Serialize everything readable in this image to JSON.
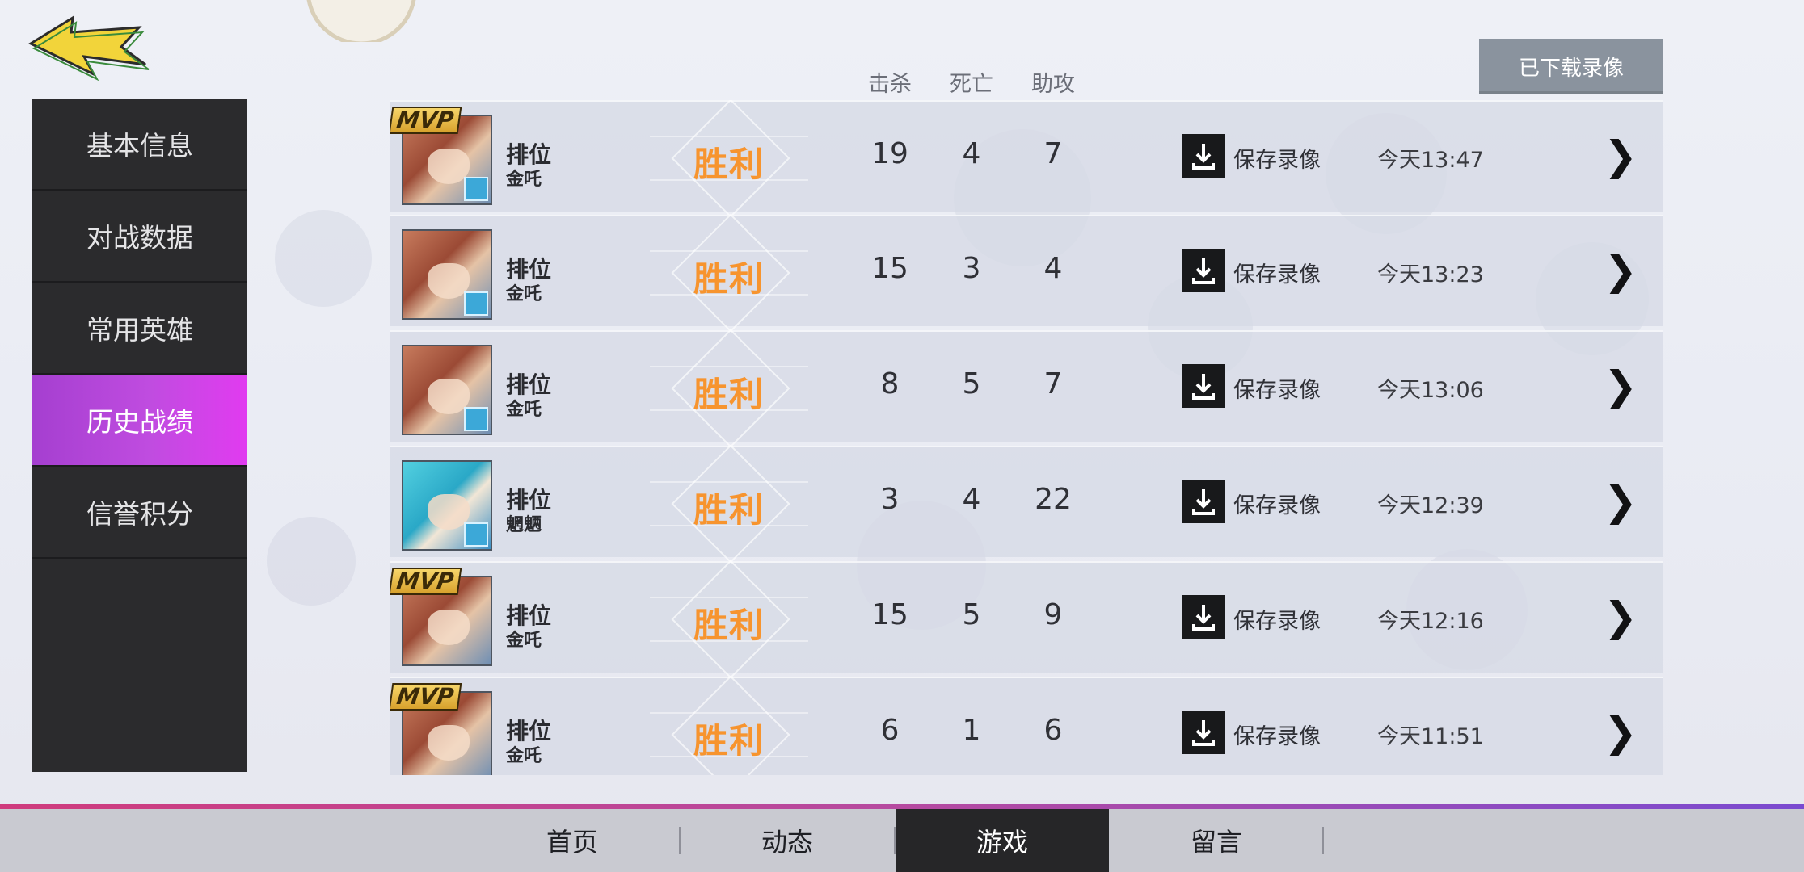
{
  "sidebar": {
    "items": [
      {
        "label": "基本信息"
      },
      {
        "label": "对战数据"
      },
      {
        "label": "常用英雄"
      },
      {
        "label": "历史战绩"
      },
      {
        "label": "信誉积分"
      }
    ]
  },
  "stats_header": {
    "kills": "击杀",
    "deaths": "死亡",
    "assists": "助攻"
  },
  "downloaded_button": "已下载录像",
  "matches": [
    {
      "mvp": "MVP",
      "mode": "排位",
      "hero": "金吒",
      "result": "胜利",
      "kills": "19",
      "deaths": "4",
      "assists": "7",
      "save": "保存录像",
      "time": "今天13:47"
    },
    {
      "mvp": "",
      "mode": "排位",
      "hero": "金吒",
      "result": "胜利",
      "kills": "15",
      "deaths": "3",
      "assists": "4",
      "save": "保存录像",
      "time": "今天13:23"
    },
    {
      "mvp": "",
      "mode": "排位",
      "hero": "金吒",
      "result": "胜利",
      "kills": "8",
      "deaths": "5",
      "assists": "7",
      "save": "保存录像",
      "time": "今天13:06"
    },
    {
      "mvp": "",
      "mode": "排位",
      "hero": "魍魉",
      "result": "胜利",
      "kills": "3",
      "deaths": "4",
      "assists": "22",
      "save": "保存录像",
      "time": "今天12:39"
    },
    {
      "mvp": "MVP",
      "mode": "排位",
      "hero": "金吒",
      "result": "胜利",
      "kills": "15",
      "deaths": "5",
      "assists": "9",
      "save": "保存录像",
      "time": "今天12:16"
    },
    {
      "mvp": "MVP",
      "mode": "排位",
      "hero": "金吒",
      "result": "胜利",
      "kills": "6",
      "deaths": "1",
      "assists": "6",
      "save": "保存录像",
      "time": "今天11:51"
    }
  ],
  "bottom_nav": {
    "tabs": [
      {
        "label": "首页"
      },
      {
        "label": "动态"
      },
      {
        "label": "游戏"
      },
      {
        "label": "留言"
      }
    ],
    "active": "游戏"
  },
  "colors": {
    "accent_purple": "#c04ce0",
    "result_orange": "#f7942e",
    "back_arrow_yellow": "#f2d43a"
  },
  "icons": [
    "back-arrow-icon",
    "download-icon",
    "chevron-right-icon",
    "mvp-badge-icon"
  ]
}
